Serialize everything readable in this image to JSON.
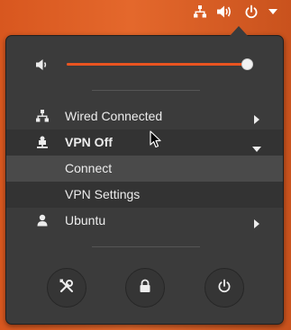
{
  "colors": {
    "accent": "#e95420",
    "menu_bg": "#3b3b3b",
    "hover_bg": "#4a4a4a",
    "text": "#ececec"
  },
  "topbar": {
    "icons": [
      "network-wired-icon",
      "volume-high-icon",
      "power-icon",
      "chevron-down-icon"
    ]
  },
  "volume": {
    "icon": "volume-low-icon",
    "level": 0.97
  },
  "menu": {
    "wired": {
      "label": "Wired Connected",
      "icon": "network-wired-icon"
    },
    "vpn": {
      "label": "VPN Off",
      "icon": "vpn-icon",
      "expanded": true
    },
    "vpn_items": [
      {
        "label": "Connect",
        "hovered": true
      },
      {
        "label": "VPN Settings"
      }
    ],
    "user": {
      "label": "Ubuntu",
      "icon": "user-icon"
    }
  },
  "actions": [
    {
      "name": "settings",
      "icon": "settings-tools-icon"
    },
    {
      "name": "lock",
      "icon": "lock-icon"
    },
    {
      "name": "power",
      "icon": "power-icon"
    }
  ]
}
